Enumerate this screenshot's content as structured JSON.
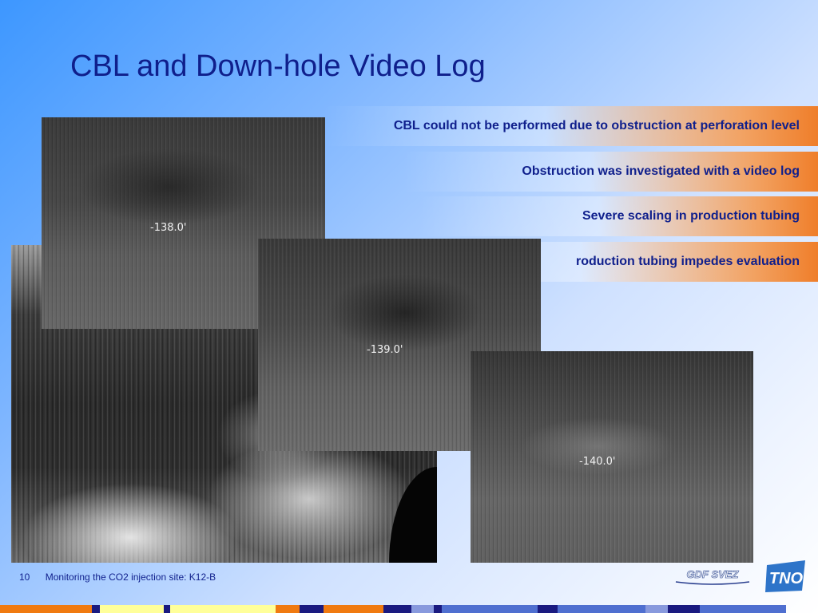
{
  "slide": {
    "title": "CBL and Down-hole Video Log",
    "bullets": [
      "CBL could not be performed due to obstruction at perforation level",
      "Obstruction was investigated with a video log",
      "Severe scaling in production tubing",
      "roduction tubing impedes evaluation"
    ],
    "video_frames": [
      {
        "depth_label": "-138.0'"
      },
      {
        "depth_label": "-139.0'"
      },
      {
        "depth_label": "-140.0'"
      }
    ],
    "footer": {
      "page_number": "10",
      "text": "Monitoring the CO2 injection site: K12-B"
    },
    "logos": {
      "gdf_suez": "GDF SVEZ",
      "tno": "TNO"
    }
  },
  "colors": {
    "title_text": "#0f1f8c",
    "bullet_accent": "#ef7e2a",
    "strip_orange": "#f07a10",
    "strip_yellow": "#ffff99",
    "strip_navy": "#1a1a80",
    "strip_blue": "#4f6fd0"
  }
}
